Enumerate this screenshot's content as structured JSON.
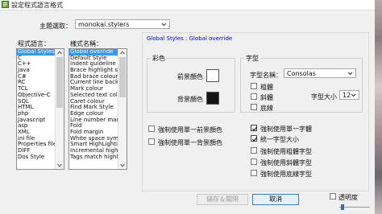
{
  "window": {
    "title": "設定程式語言格式"
  },
  "theme": {
    "label": "主題選取：",
    "value": "monokai.stylers"
  },
  "languages": {
    "label": "程式語言：",
    "items": [
      "Global Styles",
      "C",
      "C++",
      "Java",
      "C#",
      "RC",
      "TCL",
      "Objective-C",
      "SQL",
      "HTML",
      "php",
      "Javascript",
      "asp",
      "XML",
      "ini file",
      "Properties file",
      "DIFF",
      "Dos Style"
    ],
    "selected_index": 0
  },
  "styles": {
    "label": "樣式名稱：",
    "items": [
      "Global override",
      "Default Style",
      "Indent guideline style",
      "Brace highlight style",
      "Bad brace colour",
      "Current line background",
      "Mark colour",
      "Selected text colour",
      "Caret colour",
      "Find Mark Style",
      "Edge colour",
      "Line number margin",
      "Fold",
      "Fold margin",
      "White space symbol",
      "Smart HighLighting",
      "Incremental highlight",
      "Tags match highlight"
    ],
    "selected_index": 0
  },
  "header_text": "Global Styles : Global override",
  "colour_group": {
    "title": "彩色",
    "fg_label": "前景顏色",
    "bg_label": "背景顏色",
    "fg_color": "#ffffff",
    "bg_color": "#141414"
  },
  "font_group": {
    "title": "字型",
    "name_label": "字型名稱：",
    "name_value": "Consolas",
    "bold_label": "粗體",
    "italic_label": "斜體",
    "underline_label": "底線",
    "size_label": "字型大小",
    "size_value": "12"
  },
  "options_left": [
    {
      "label": "強制使用單一前景顏色",
      "checked": false
    },
    {
      "label": "強制使用單一背景顏色",
      "checked": false
    }
  ],
  "options_right": [
    {
      "label": "強制使用單一字體",
      "checked": true
    },
    {
      "label": "統一字型大小",
      "checked": true
    },
    {
      "label": "強制使用粗體字型",
      "checked": false
    },
    {
      "label": "強制使用斜體字型",
      "checked": false
    },
    {
      "label": "強制使用底線字型",
      "checked": false
    }
  ],
  "buttons": {
    "save": "儲存＆關閉",
    "cancel": "取消"
  },
  "transparency": {
    "label": "透明度",
    "checked": false
  },
  "colors": {
    "selection": "#3399ff",
    "link_blue": "#0000ff"
  }
}
